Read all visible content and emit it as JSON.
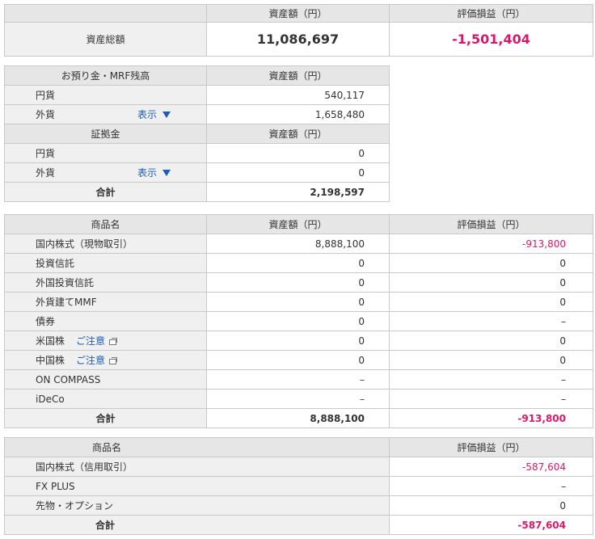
{
  "summary": {
    "header_asset": "資産額（円）",
    "header_pl": "評価損益（円）",
    "row_label": "資産総額",
    "total_asset": "11,086,697",
    "total_pl": "-1,501,404"
  },
  "deposits": {
    "header_label": "お預り金・MRF残高",
    "header_asset": "資産額（円）",
    "rows": [
      {
        "label": "円貨",
        "value": "540,117"
      },
      {
        "label": "外貨",
        "toggle": "表示",
        "value": "1,658,480"
      }
    ],
    "margin_header": "証拠金",
    "margin_asset_header": "資産額（円）",
    "margin_rows": [
      {
        "label": "円貨",
        "value": "0"
      },
      {
        "label": "外貨",
        "toggle": "表示",
        "value": "0"
      }
    ],
    "total_label": "合計",
    "total_value": "2,198,597"
  },
  "products": {
    "header_name": "商品名",
    "header_asset": "資産額（円）",
    "header_pl": "評価損益（円）",
    "rows": [
      {
        "name": "国内株式（現物取引）",
        "asset": "8,888,100",
        "pl": "-913,800"
      },
      {
        "name": "投資信託",
        "asset": "0",
        "pl": "0"
      },
      {
        "name": "外国投資信託",
        "asset": "0",
        "pl": "0"
      },
      {
        "name": "外貨建てMMF",
        "asset": "0",
        "pl": "0"
      },
      {
        "name": "債券",
        "asset": "0",
        "pl": "–"
      },
      {
        "name": "米国株",
        "notice": "ご注意",
        "asset": "0",
        "pl": "0"
      },
      {
        "name": "中国株",
        "notice": "ご注意",
        "asset": "0",
        "pl": "0"
      },
      {
        "name": "ON COMPASS",
        "asset": "–",
        "pl": "–"
      },
      {
        "name": "iDeCo",
        "asset": "–",
        "pl": "–"
      }
    ],
    "total_label": "合計",
    "total_asset": "8,888,100",
    "total_pl": "-913,800"
  },
  "credit": {
    "header_name": "商品名",
    "header_pl": "評価損益（円）",
    "rows": [
      {
        "name": "国内株式（信用取引）",
        "pl": "-587,604"
      },
      {
        "name": "FX PLUS",
        "pl": "–"
      },
      {
        "name": "先物・オプション",
        "pl": "0"
      }
    ],
    "total_label": "合計",
    "total_pl": "-587,604"
  },
  "colors": {
    "negative": "#d6196b",
    "link": "#1a5fb4",
    "header_bg": "#e6e6e6",
    "label_bg": "#f0f0f0"
  }
}
